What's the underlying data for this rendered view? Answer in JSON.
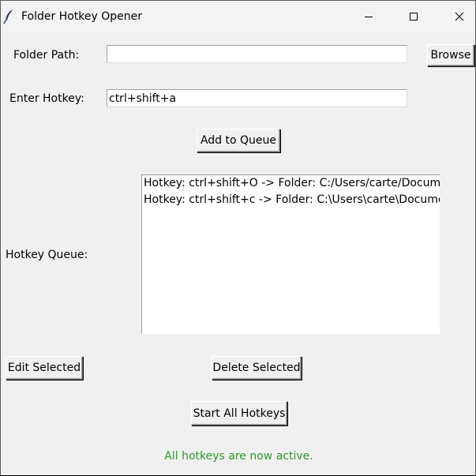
{
  "window": {
    "title": "Folder Hotkey Opener"
  },
  "folder": {
    "label": "Folder Path:",
    "value": "",
    "browse_label": "Browse"
  },
  "hotkey": {
    "label": "Enter Hotkey:",
    "value": "ctrl+shift+a"
  },
  "queue": {
    "add_label": "Add to Queue",
    "label": "Hotkey Queue:",
    "items": [
      "Hotkey: ctrl+shift+O -> Folder: C:/Users/carte/Documents",
      "Hotkey: ctrl+shift+c -> Folder: C:\\Users\\carte\\Documents"
    ]
  },
  "actions": {
    "edit_label": "Edit Selected",
    "delete_label": "Delete Selected",
    "start_label": "Start All Hotkeys"
  },
  "status": {
    "text": "All hotkeys are now active.",
    "color": "#2d9a2d"
  },
  "icons": {
    "app": "feather-icon",
    "minimize": "minimize-icon",
    "maximize": "maximize-icon",
    "close": "close-icon"
  }
}
